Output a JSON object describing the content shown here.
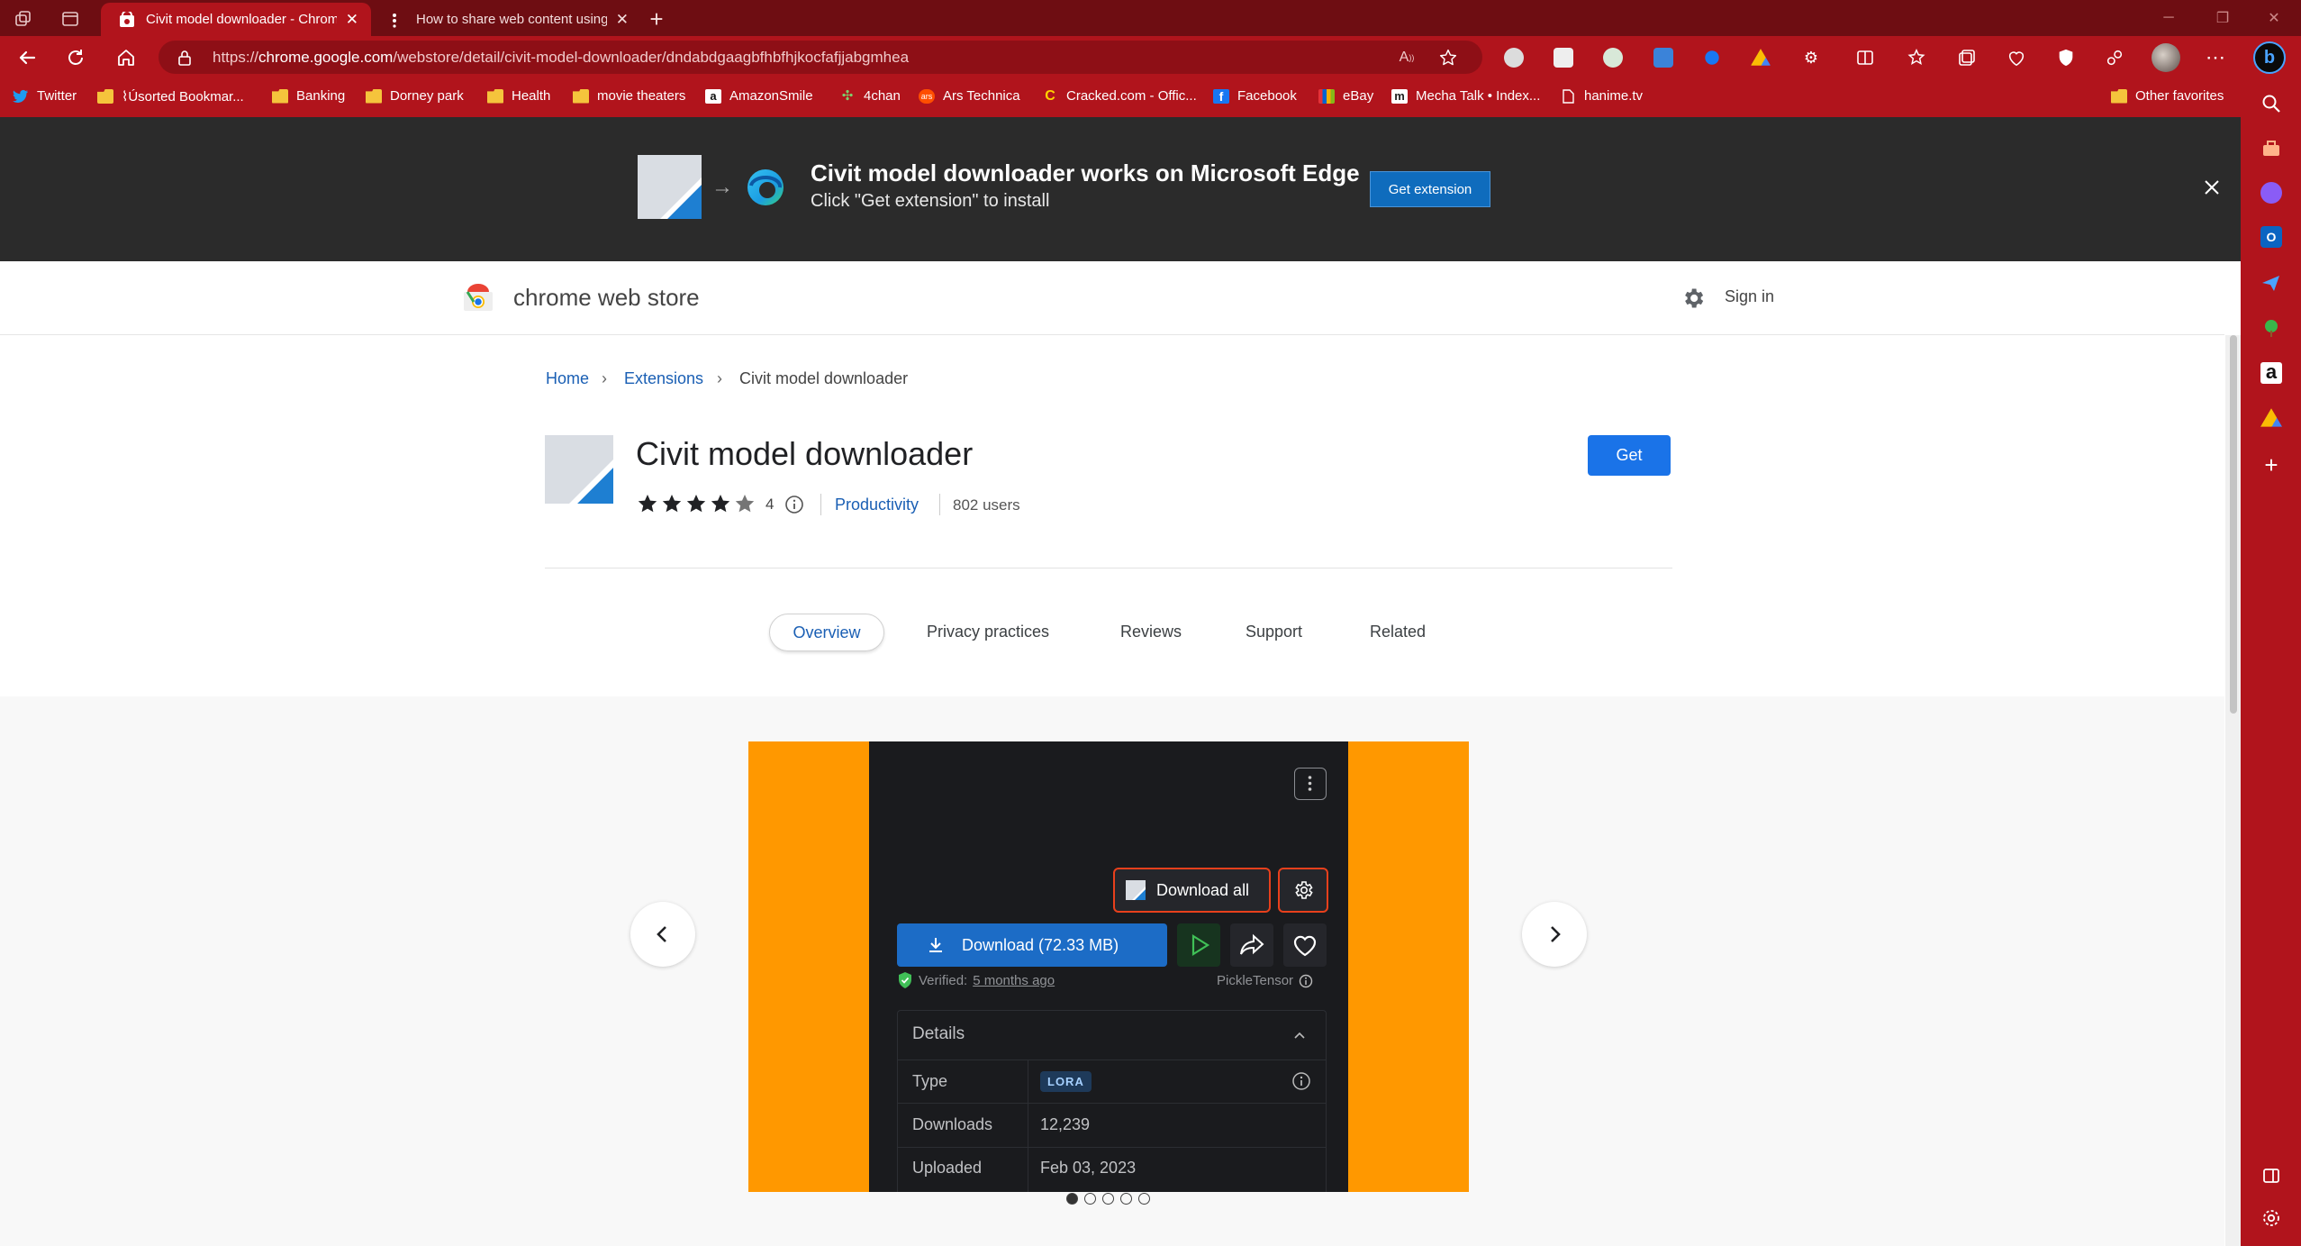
{
  "browser": {
    "tabs": [
      {
        "title": "Civit model downloader - Chrome Web Store",
        "active": true
      },
      {
        "title": "How to share web content using Microsoft Edge",
        "active": false
      }
    ],
    "new_tab_symbol": "+",
    "url_prefix": "https://",
    "url_host": "chrome.google.com",
    "url_path": "/webstore/detail/civit-model-downloader/dndabdgaagbfhbfhjkocfafjjabgmhea",
    "accent_color": "#b1141c",
    "tabstrip_color": "#6e0d12"
  },
  "bookmarks": {
    "items": [
      {
        "label": "Twitter",
        "icon": "twitter-icon"
      },
      {
        "label": "⌇Úsorted Bookmar...",
        "icon": "folder-icon"
      },
      {
        "label": "Banking",
        "icon": "folder-icon"
      },
      {
        "label": "Dorney park",
        "icon": "folder-icon"
      },
      {
        "label": "Health",
        "icon": "folder-icon"
      },
      {
        "label": "movie theaters",
        "icon": "folder-icon"
      },
      {
        "label": "AmazonSmile",
        "icon": "amazon-icon"
      },
      {
        "label": "4chan",
        "icon": "clover-icon"
      },
      {
        "label": "Ars Technica",
        "icon": "ars-icon"
      },
      {
        "label": "Cracked.com - Offic...",
        "icon": "cracked-icon"
      },
      {
        "label": "Facebook",
        "icon": "facebook-icon"
      },
      {
        "label": "eBay",
        "icon": "ebay-icon"
      },
      {
        "label": "Mecha Talk • Index...",
        "icon": "m-icon"
      },
      {
        "label": "hanime.tv",
        "icon": "page-icon"
      }
    ],
    "other_favorites": "Other favorites"
  },
  "banner": {
    "title": "Civit model downloader works on Microsoft Edge",
    "subtitle": "Click \"Get extension\" to install",
    "button": "Get extension"
  },
  "store": {
    "name": "chrome web store",
    "sign_in": "Sign in"
  },
  "breadcrumb": {
    "home": "Home",
    "extensions": "Extensions",
    "current": "Civit model downloader"
  },
  "extension": {
    "title": "Civit model downloader",
    "rating": "4",
    "rating_value": 4,
    "rating_max": 5,
    "category": "Productivity",
    "users": "802 users",
    "get_button": "Get"
  },
  "page_tabs": [
    {
      "label": "Overview",
      "active": true
    },
    {
      "label": "Privacy practices"
    },
    {
      "label": "Reviews"
    },
    {
      "label": "Support"
    },
    {
      "label": "Related"
    }
  ],
  "screenshot": {
    "download_all": "Download all",
    "download": "Download (72.33 MB)",
    "verified_prefix": "Verified:",
    "verified_time": "5 months ago",
    "pickle": "PickleTensor",
    "details_title": "Details",
    "rows": [
      {
        "label": "Type",
        "value": "LORA"
      },
      {
        "label": "Downloads",
        "value": "12,239"
      },
      {
        "label": "Uploaded",
        "value": "Feb 03, 2023"
      }
    ]
  },
  "carousel": {
    "count": 5,
    "active_index": 0
  }
}
